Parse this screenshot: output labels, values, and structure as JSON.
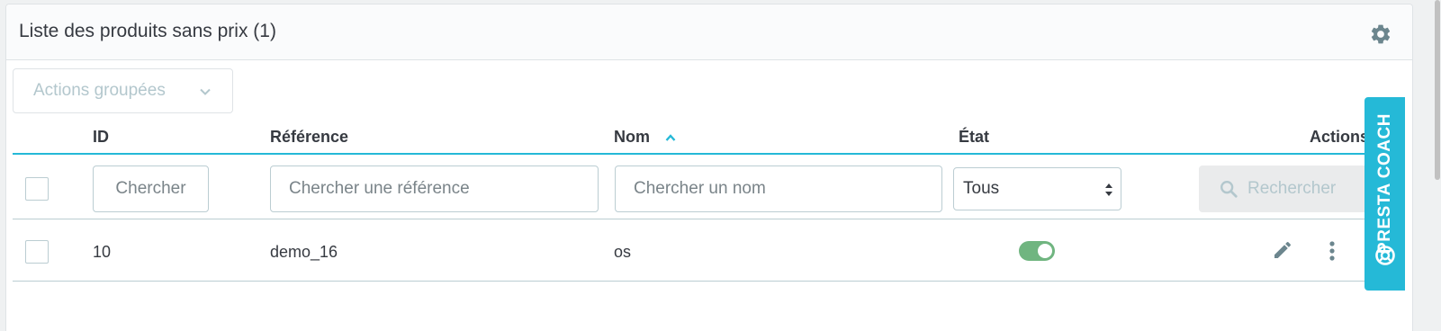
{
  "panel": {
    "title": "Liste des produits sans prix (1)",
    "settings_icon": "gear-icon"
  },
  "bulk_actions": {
    "label": "Actions groupées",
    "icon": "chevron-down-icon"
  },
  "table": {
    "columns": {
      "id": "ID",
      "reference": "Référence",
      "name": "Nom",
      "state": "État",
      "actions": "Actions"
    },
    "sort": {
      "column": "name",
      "direction": "asc"
    },
    "filters": {
      "id_placeholder": "Chercher",
      "reference_placeholder": "Chercher une référence",
      "name_placeholder": "Chercher un nom",
      "state_selected": "Tous",
      "search_button": "Rechercher"
    },
    "rows": [
      {
        "id": "10",
        "reference": "demo_16",
        "name": "os",
        "enabled": true
      }
    ]
  },
  "coach": {
    "label": "PRESTA COACH",
    "icon": "lifebuoy-icon"
  },
  "colors": {
    "accent": "#25b9d7",
    "toggle_on": "#70b580",
    "border": "#bbcdd2",
    "muted": "#b3c7cd"
  }
}
